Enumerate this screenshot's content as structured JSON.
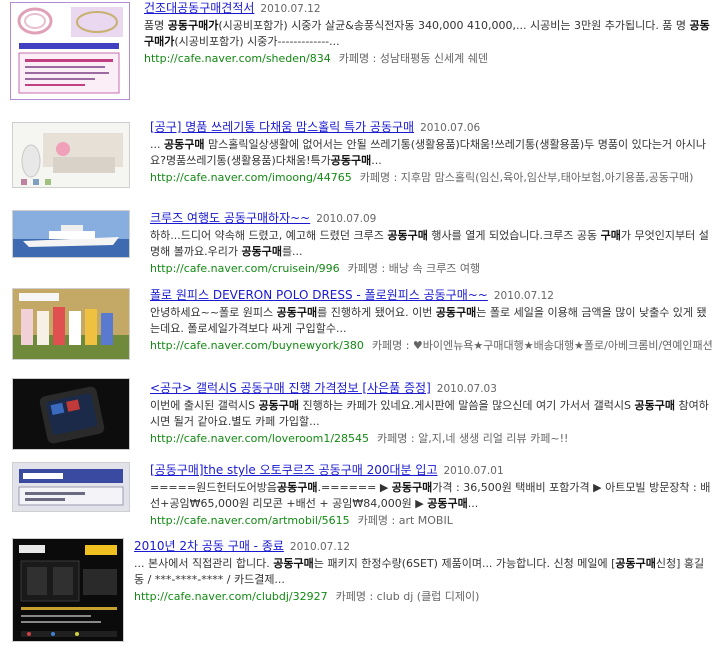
{
  "results": [
    {
      "title_pre": "",
      "title_bold": "",
      "title_post": "건조대공동구매견적서",
      "date": "2010.07.12",
      "snippet": [
        [
          [
            "",
            false
          ],
          [
            "품명 ",
            false
          ],
          [
            "공동구매가",
            true
          ],
          [
            "(시공비포함가) 시중가 살균&송풍식전자동 340,000 410,000,... 시공비는 3만원 추가됩니다. 품 명 ",
            false
          ],
          [
            "공동구매가",
            true
          ],
          [
            "(시공비포함가) 시중가-------------...",
            false
          ]
        ]
      ],
      "url": "http://cafe.naver.com/sheden/834",
      "cafe": "카페명 : 성남태평동 신세계 쉐덴"
    },
    {
      "title_post": "[공구] 명품 쓰레기통 다채움 맘스홀릭 특가 공동구매",
      "date": "2010.07.06",
      "snippet": [
        [
          [
            "... ",
            false
          ],
          [
            "공동구매",
            true
          ],
          [
            " 맘스홀릭일상생활에 없어서는 안될 쓰레기통(생활용품)다채움!쓰레기통(생활용품)두 명품이 있다는거 아시나요?명품쓰레기통(생활용품)다채움!특가",
            false
          ],
          [
            "공동구매",
            true
          ],
          [
            "...",
            false
          ]
        ]
      ],
      "url": "http://cafe.naver.com/imoong/44765",
      "cafe": "카페명 : 지후맘 맘스홀릭(임신,육아,임산부,태아보험,아기용품,공동구매)"
    },
    {
      "title_post": "크루즈 여행도 공동구매하자~~",
      "date": "2010.07.09",
      "snippet": [
        [
          [
            "하하...드디어 약속해 드렸고, 예고해 드렸던 크루즈 ",
            false
          ],
          [
            "공동구매",
            true
          ],
          [
            " 행사를 열게 되었습니다.크루즈 공동 ",
            false
          ],
          [
            "구매",
            true
          ],
          [
            "가 무엇인지부터 설명해 볼까요.우리가 ",
            false
          ],
          [
            "공동구매",
            true
          ],
          [
            "를...",
            false
          ]
        ]
      ],
      "url": "http://cafe.naver.com/cruisein/996",
      "cafe": "카페명 : 배낭 속 크루즈 여행"
    },
    {
      "title_post": "폴로 원피스 DEVERON POLO DRESS - 폴로원피스 공동구매~~",
      "date": "2010.07.12",
      "snippet": [
        [
          [
            "안녕하세요~~폴로 원피스 ",
            false
          ],
          [
            "공동구매",
            true
          ],
          [
            "를 진행하게 됐어요. 이번 ",
            false
          ],
          [
            "공동구매",
            true
          ],
          [
            "는 폴로 세일을 이용해 금액을 많이 낮출수 있게 됐는데요. 폴로세일가격보다 싸게 구입할수...",
            false
          ]
        ]
      ],
      "url": "http://cafe.naver.com/buynewyork/380",
      "cafe": "카페명 : ♥바이엔뉴욕★구매대행★배송대행★폴로/아베크롬비/연예인패션"
    },
    {
      "title_post": "<공구> 갤럭시S 공동구매 진행 가격정보 [사은품 증정]",
      "date": "2010.07.03",
      "snippet": [
        [
          [
            "이번에 출시된 갤럭시S ",
            false
          ],
          [
            "공동구매",
            true
          ],
          [
            " 진행하는 카페가 있네요.게시판에 말씀을 많으신데 여기 가서서 갤럭시S ",
            false
          ],
          [
            "공동구매",
            true
          ],
          [
            " 참여하시면 될거 같아요.별도 카페 가입할...",
            false
          ]
        ]
      ],
      "url": "http://cafe.naver.com/loveroom1/28545",
      "cafe": "카페명 : 알,지,네 생생 리얼 리뷰 카페~!!"
    },
    {
      "title_post": "[공동구매]the style 오토쿠르즈 공동구매 200대분 입고",
      "date": "2010.07.01",
      "snippet": [
        [
          [
            "=====원드헌터도어방음",
            false
          ],
          [
            "공동구매",
            true
          ],
          [
            ".====== ▶ ",
            false
          ],
          [
            "공동구매",
            true
          ],
          [
            "가격 : 36,500원 택배비 포함가격 ▶ 아트모빌 방문장착 : 배선+공임₩65,000원 리모콘 +배선 + 공임₩84,000원 ▶ ",
            false
          ],
          [
            "공동구매",
            true
          ],
          [
            "...",
            false
          ]
        ]
      ],
      "url": "http://cafe.naver.com/artmobil/5615",
      "cafe": "카페명 : art MOBIL"
    },
    {
      "title_post": "2010년 2차 공동 구매 - 종료",
      "date": "2010.07.12",
      "snippet": [
        [
          [
            "... 본사에서 직접관리 합니다. ",
            false
          ],
          [
            "공동구매",
            true
          ],
          [
            "는 패키지 한정수량(6SET) 제품이며... 가능합니다. 신청 메일에 [",
            false
          ],
          [
            "공동구매",
            true
          ],
          [
            "신청] 홍길동 / ***-****-**** / 카드결제...",
            false
          ]
        ]
      ],
      "url": "http://cafe.naver.com/clubdj/32927",
      "cafe": "카페명 : club dj (클럽 디제이)"
    }
  ]
}
